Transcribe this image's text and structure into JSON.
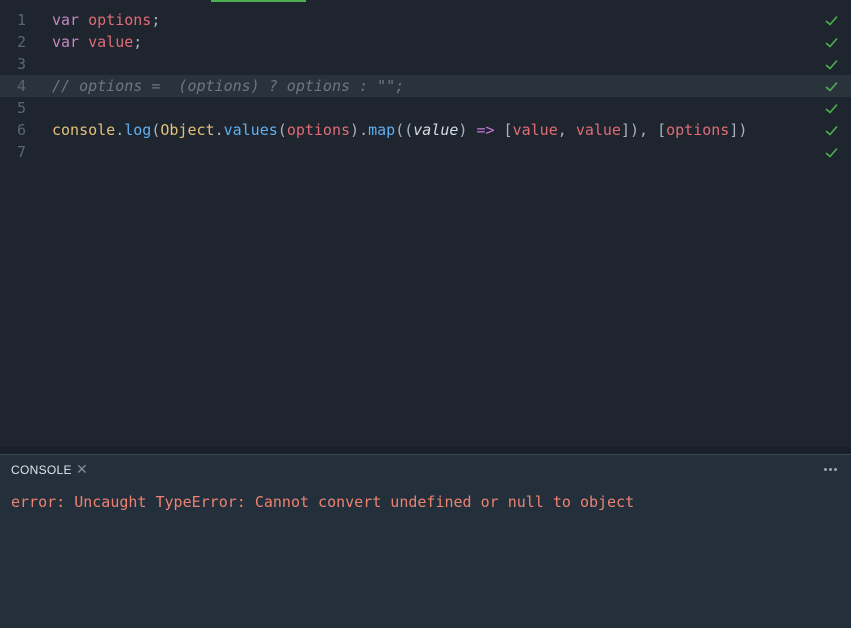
{
  "editor": {
    "line_numbers": [
      "1",
      "2",
      "3",
      "4",
      "5",
      "6",
      "7"
    ],
    "line1": {
      "keyword": "var",
      "ident": "options",
      "semi": ";"
    },
    "line2": {
      "keyword": "var",
      "ident": "value",
      "semi": ";"
    },
    "line4": {
      "comment": "// options =  (options) ? options : \"\";"
    },
    "line6": {
      "console": "console",
      "dot1": ".",
      "log": "log",
      "paren_open": "(",
      "object": "Object",
      "dot2": ".",
      "values": "values",
      "paren2_open": "(",
      "arg_options": "options",
      "paren2_close": ")",
      "dot3": ".",
      "map": "map",
      "paren3_open": "((",
      "param": "value",
      "paren3_close": ") ",
      "arrow": "=>",
      "bracket_open": " [",
      "value_a": "value",
      "comma": ", ",
      "value_b": "value",
      "close_seq": "]), [",
      "options_b": "options",
      "end": "])"
    },
    "status_icon": "checkmark-icon",
    "colors": {
      "keyword": "#c586c0",
      "identifier": "#e06c75",
      "comment": "#6e7781",
      "object": "#e5c07b",
      "function": "#61afef",
      "check": "#4caf50",
      "error": "#ee8271"
    }
  },
  "console": {
    "title": "CONSOLE",
    "close_icon": "close-icon",
    "menu_icon": "more-horizontal-icon",
    "error_text": "error: Uncaught TypeError: Cannot convert undefined or null to object"
  }
}
